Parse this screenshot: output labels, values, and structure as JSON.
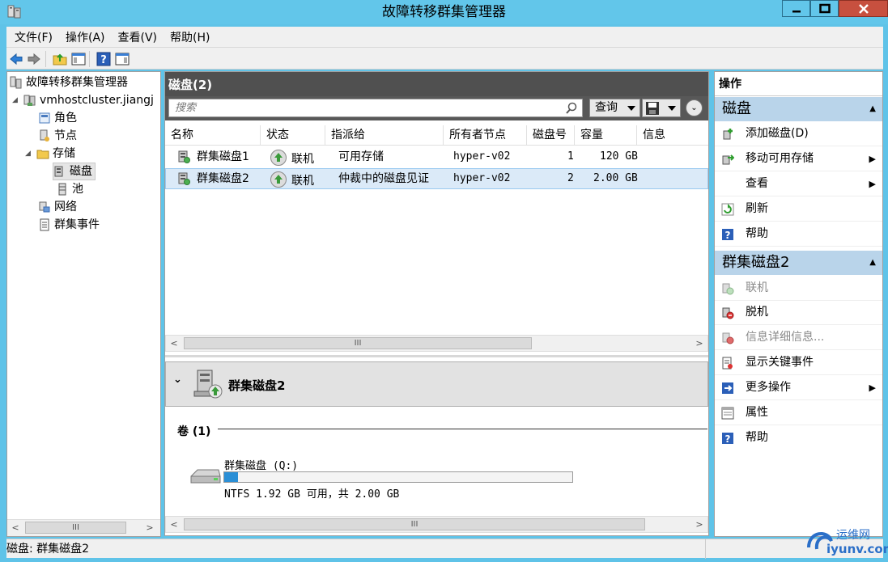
{
  "window": {
    "title": "故障转移群集管理器"
  },
  "menu": [
    "文件(F)",
    "操作(A)",
    "查看(V)",
    "帮助(H)"
  ],
  "tree": {
    "root": "故障转移群集管理器",
    "cluster": "vmhostcluster.jiangj",
    "roles": "角色",
    "nodes": "节点",
    "storage": "存储",
    "disks": "磁盘",
    "pools": "池",
    "networks": "网络",
    "events": "群集事件"
  },
  "center": {
    "header": "磁盘(2)",
    "search_placeholder": "搜索",
    "query_label": "查询",
    "columns": [
      "名称",
      "状态",
      "指派给",
      "所有者节点",
      "磁盘号",
      "容量",
      "信息"
    ],
    "rows": [
      {
        "name": "群集磁盘1",
        "status": "联机",
        "assigned": "可用存储",
        "owner": "hyper-v02",
        "disk_no": "1",
        "capacity": "120 GB",
        "selected": false
      },
      {
        "name": "群集磁盘2",
        "status": "联机",
        "assigned": "仲裁中的磁盘见证",
        "owner": "hyper-v02",
        "disk_no": "2",
        "capacity": "2.00 GB",
        "selected": true
      }
    ],
    "detail": {
      "title": "群集磁盘2",
      "volumes_header": "卷 (1)",
      "volume_name": "群集磁盘 (Q:)",
      "volume_info": "NTFS 1.92 GB 可用，共 2.00 GB",
      "used_fraction": 0.04
    },
    "scroll_thumb": "III"
  },
  "actions": {
    "title": "操作",
    "section1": {
      "header": "磁盘",
      "items": [
        {
          "label": "添加磁盘(D)",
          "icon": "add-disk-icon",
          "submenu": false,
          "enabled": true
        },
        {
          "label": "移动可用存储",
          "icon": "move-storage-icon",
          "submenu": true,
          "enabled": true
        },
        {
          "label": "查看",
          "icon": "",
          "submenu": true,
          "enabled": true
        },
        {
          "label": "刷新",
          "icon": "refresh-icon",
          "submenu": false,
          "enabled": true
        },
        {
          "label": "帮助",
          "icon": "help-icon",
          "submenu": false,
          "enabled": true
        }
      ]
    },
    "section2": {
      "header": "群集磁盘2",
      "items": [
        {
          "label": "联机",
          "icon": "online-icon",
          "submenu": false,
          "enabled": false
        },
        {
          "label": "脱机",
          "icon": "offline-icon",
          "submenu": false,
          "enabled": true
        },
        {
          "label": "信息详细信息...",
          "icon": "info-details-icon",
          "submenu": false,
          "enabled": false
        },
        {
          "label": "显示关键事件",
          "icon": "critical-events-icon",
          "submenu": false,
          "enabled": true
        },
        {
          "label": "更多操作",
          "icon": "more-actions-icon",
          "submenu": true,
          "enabled": true
        },
        {
          "label": "属性",
          "icon": "properties-icon",
          "submenu": false,
          "enabled": true
        },
        {
          "label": "帮助",
          "icon": "help-icon",
          "submenu": false,
          "enabled": true
        }
      ]
    }
  },
  "statusbar": {
    "text": "磁盘: 群集磁盘2"
  },
  "watermark": {
    "line1": "运维网",
    "line2": "iyunv.com"
  }
}
